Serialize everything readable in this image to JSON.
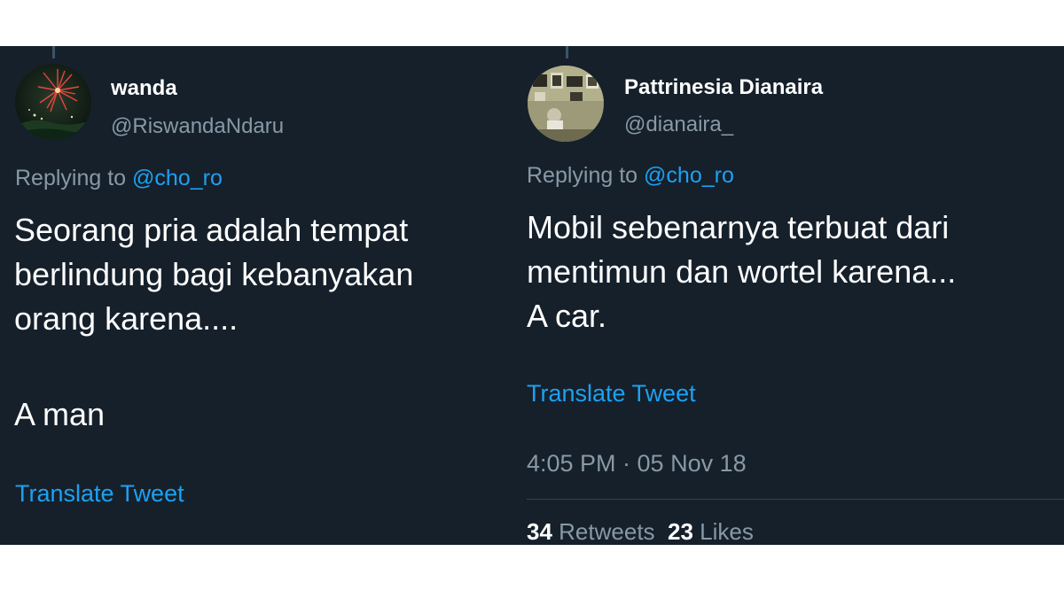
{
  "tweets": [
    {
      "name": "wanda",
      "handle": "@RiswandaNdaru",
      "reply_prefix": "Replying to",
      "reply_mention": "@cho_ro",
      "text_lines": [
        "Seorang pria adalah tempat",
        "berlindung bagi kebanyakan",
        "orang karena....",
        "",
        "A man"
      ],
      "translate_label": "Translate Tweet"
    },
    {
      "name": "Pattrinesia Dianaira",
      "handle": "@dianaira_",
      "reply_prefix": "Replying to",
      "reply_mention": "@cho_ro",
      "text_lines": [
        "Mobil sebenarnya terbuat dari",
        "mentimun dan wortel karena...",
        "A car."
      ],
      "translate_label": "Translate Tweet",
      "timestamp": "4:05 PM · 05 Nov 18",
      "retweets_count": "34",
      "retweets_label": "Retweets",
      "likes_count": "23",
      "likes_label": "Likes"
    }
  ],
  "colors": {
    "background": "#15202b",
    "text_primary": "#ffffff",
    "text_secondary": "#8899a6",
    "link": "#1da1f2"
  }
}
